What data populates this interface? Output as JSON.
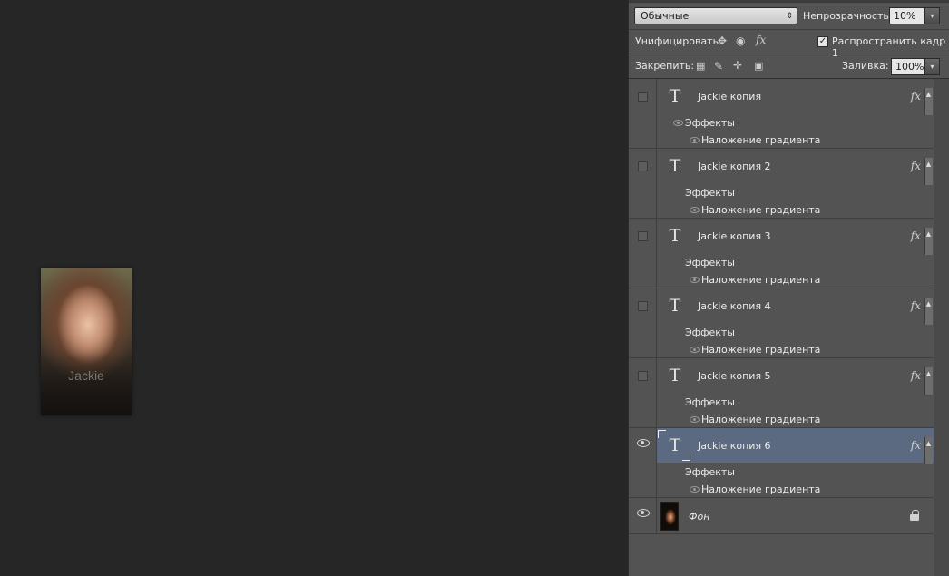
{
  "canvas": {
    "image_text": "Jackie"
  },
  "panel": {
    "blend_mode": "Обычные",
    "opacity_label": "Непрозрачность:",
    "opacity_value": "10%",
    "unify_label": "Унифицировать:",
    "propagate_label": "Распространить кадр 1",
    "lock_label": "Закрепить:",
    "fill_label": "Заливка:",
    "fill_value": "100%"
  },
  "layers": [
    {
      "name": "Jackie копия",
      "visible": false,
      "selected": false,
      "effects_label": "Эффекты",
      "effect": "Наложение градиента",
      "fx": "fx"
    },
    {
      "name": "Jackie копия 2",
      "visible": false,
      "selected": false,
      "effects_label": "Эффекты",
      "effect": "Наложение градиента",
      "fx": "fx"
    },
    {
      "name": "Jackie копия 3",
      "visible": false,
      "selected": false,
      "effects_label": "Эффекты",
      "effect": "Наложение градиента",
      "fx": "fx"
    },
    {
      "name": "Jackie копия 4",
      "visible": false,
      "selected": false,
      "effects_label": "Эффекты",
      "effect": "Наложение градиента",
      "fx": "fx"
    },
    {
      "name": "Jackie копия 5",
      "visible": false,
      "selected": false,
      "effects_label": "Эффекты",
      "effect": "Наложение градиента",
      "fx": "fx"
    },
    {
      "name": "Jackie копия 6",
      "visible": true,
      "selected": true,
      "effects_label": "Эффекты",
      "effect": "Наложение градиента",
      "fx": "fx"
    }
  ],
  "background_layer": {
    "name": "Фон",
    "visible": true,
    "locked": true
  },
  "icons": {
    "text_layer": "T",
    "blend_arrows": "⇕",
    "dropdown": "▾",
    "check": "✓"
  },
  "colors": {
    "selected_layer": "#5b6a80",
    "panel_bg": "#535353",
    "canvas_bg": "#262626"
  }
}
